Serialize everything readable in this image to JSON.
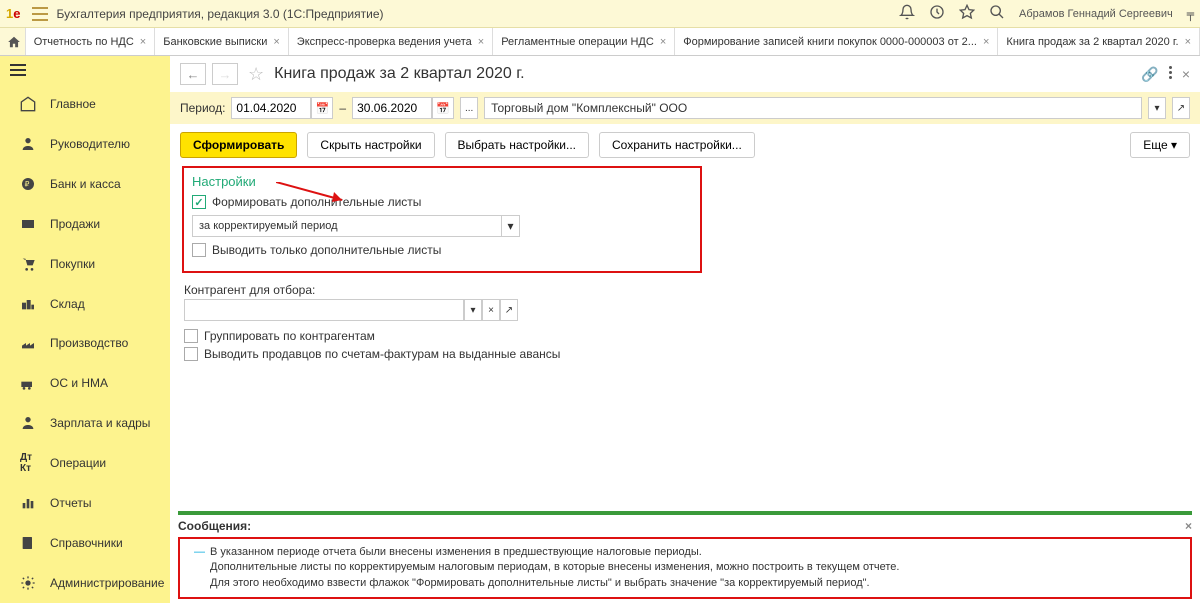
{
  "titlebar": {
    "app_title": "Бухгалтерия предприятия, редакция 3.0  (1С:Предприятие)",
    "username": "Абрамов Геннадий Сергеевич"
  },
  "tabs": [
    "Отчетность по НДС",
    "Банковские выписки",
    "Экспресс-проверка ведения учета",
    "Регламентные операции НДС",
    "Формирование записей книги покупок 0000-000003 от 2...",
    "Книга продаж за 2 квартал 2020 г."
  ],
  "sidebar": {
    "items": [
      "Главное",
      "Руководителю",
      "Банк и касса",
      "Продажи",
      "Покупки",
      "Склад",
      "Производство",
      "ОС и НМА",
      "Зарплата и кадры",
      "Операции",
      "Отчеты",
      "Справочники",
      "Администрирование"
    ]
  },
  "page": {
    "title": "Книга продаж за 2 квартал 2020 г.",
    "period_label": "Период:",
    "date_from": "01.04.2020",
    "date_to": "30.06.2020",
    "dash": "–",
    "org": "Торговый дом \"Комплексный\" ООО"
  },
  "toolbar": {
    "form": "Сформировать",
    "hide": "Скрыть настройки",
    "choose": "Выбрать настройки...",
    "save": "Сохранить настройки...",
    "more": "Еще"
  },
  "settings": {
    "title": "Настройки",
    "chk_form_dop": "Формировать дополнительные листы",
    "period_select": "за корректируемый период",
    "chk_only_dop": "Выводить только дополнительные листы"
  },
  "filter": {
    "counter_label": "Контрагент для отбора:",
    "group_by": "Группировать по контрагентам",
    "show_sellers": "Выводить продавцов по счетам-фактурам на выданные авансы"
  },
  "messages": {
    "title": "Сообщения:",
    "line1": "В указанном периоде отчета были внесены изменения в предшествующие налоговые периоды.",
    "line2": "Дополнительные листы по корректируемым налоговым периодам, в которые внесены изменения, можно построить в текущем отчете.",
    "line3": "Для этого необходимо взвести флажок \"Формировать дополнительные листы\" и выбрать значение \"за корректируемый период\"."
  }
}
